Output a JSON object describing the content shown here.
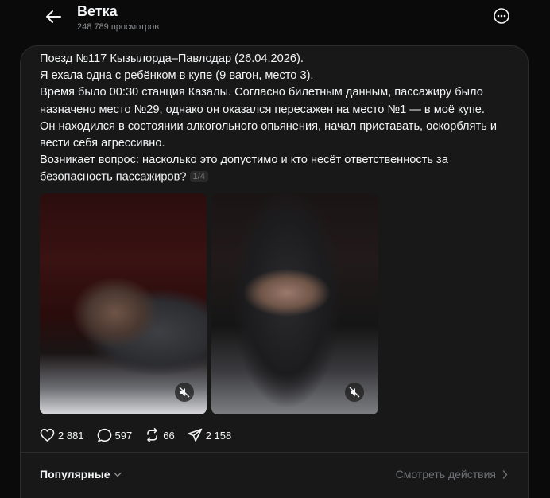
{
  "header": {
    "title": "Ветка",
    "views": "248 789 просмотров"
  },
  "post": {
    "lines": [
      "Поезд №117 Кызылорда–Павлодар (26.04.2026).",
      "Я ехала одна с ребёнком в купе (9 вагон, место 3).",
      "Время было 00:30 станция Казалы. Согласно билетным данным, пассажиру было",
      "назначено место №29, однако он оказался пересажен на место №1 — в моё купе.",
      "Он находился в состоянии алкогольного опьянения, начал приставать, оскорблять и",
      "вести себя агрессивно.",
      "Возникает вопрос: насколько это допустимо и кто несёт ответственность за",
      "безопасность пассажиров?"
    ],
    "media_counter": "1/4"
  },
  "actions": {
    "likes": "2 881",
    "replies": "597",
    "reposts": "66",
    "shares": "2 158"
  },
  "footer": {
    "sort_label": "Популярные",
    "view_activity": "Смотреть действия"
  }
}
